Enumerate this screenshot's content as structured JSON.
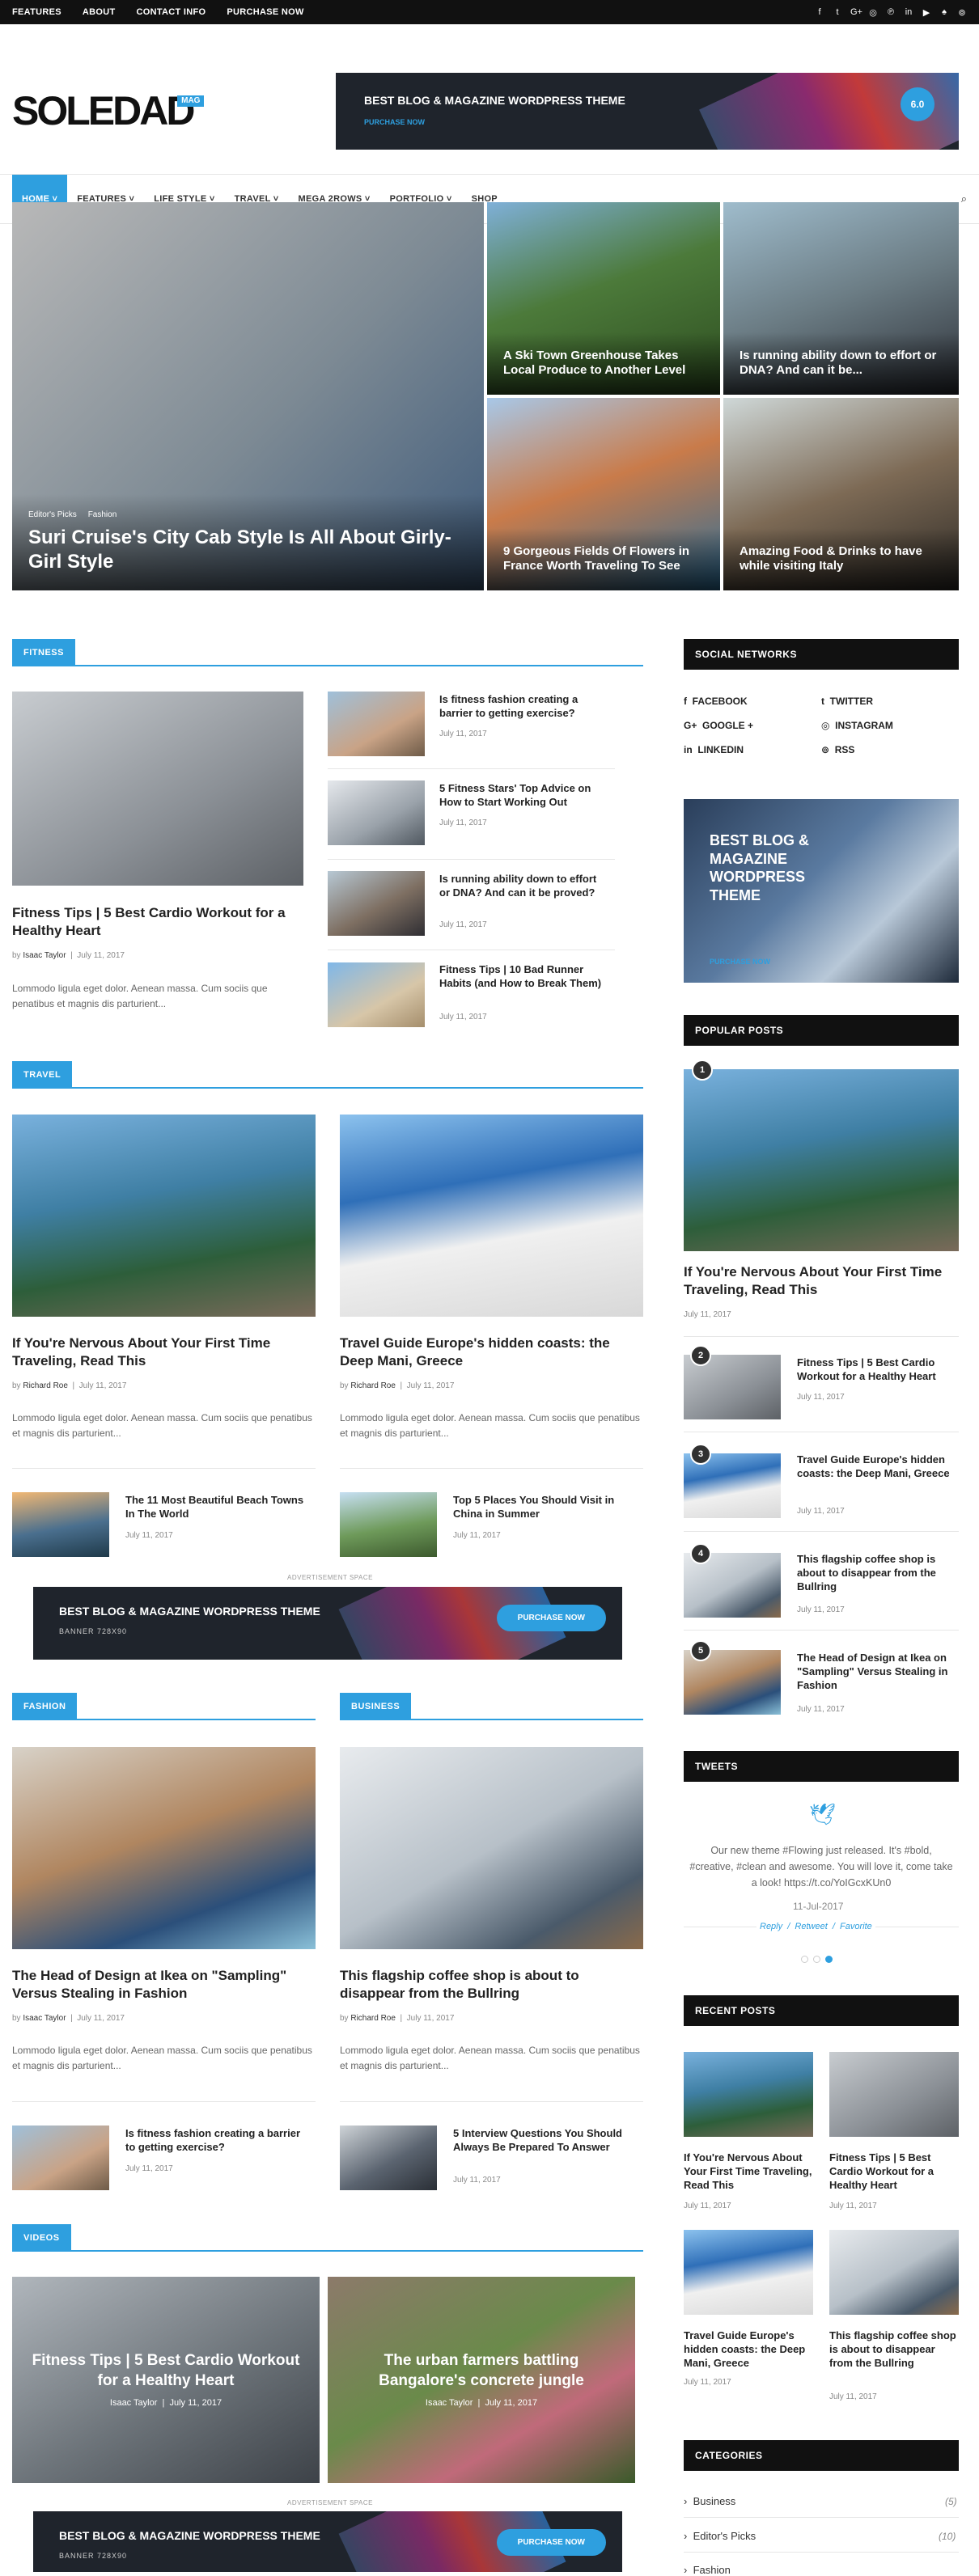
{
  "topbar": {
    "menu": [
      "FEATURES",
      "ABOUT",
      "CONTACT INFO",
      "PURCHASE NOW"
    ],
    "social_icons": [
      "facebook-icon",
      "twitter-icon",
      "google-plus-icon",
      "instagram-icon",
      "pinterest-icon",
      "linkedin-icon",
      "youtube-icon",
      "snapchat-icon",
      "rss-icon"
    ],
    "social_glyphs": [
      "f",
      "t",
      "G+",
      "◎",
      "℗",
      "in",
      "▶",
      "♠",
      "⊚"
    ]
  },
  "brand": {
    "logo": "SOLEDAD",
    "badge": "MAG"
  },
  "header_banner": {
    "title": "BEST BLOG & MAGAZINE WORDPRESS THEME",
    "cta": "PURCHASE NOW",
    "badge": "6.0"
  },
  "nav": {
    "items": [
      "HOME ˅",
      "FEATURES ˅",
      "LIFE STYLE ˅",
      "TRAVEL ˅",
      "MEGA 2ROWS ˅",
      "PORTFOLIO ˅",
      "SHOP"
    ],
    "search_glyph": "⌕"
  },
  "featured": {
    "main": {
      "tags": [
        "Editor's Picks",
        "Fashion"
      ],
      "title": "Suri Cruise's City Cab Style Is All About Girly-Girl Style"
    },
    "items": [
      "A Ski Town Greenhouse Takes Local Produce to Another Level",
      "Is running ability down to effort or DNA? And can it be...",
      "9 Gorgeous Fields Of Flowers in France Worth Traveling To See",
      "Amazing Food & Drinks to have while visiting Italy"
    ]
  },
  "fitness": {
    "heading": "FITNESS",
    "main": {
      "title": "Fitness Tips | 5 Best Cardio Workout for a Healthy Heart",
      "author": "Isaac Taylor",
      "date": "July 11, 2017",
      "excerpt": "Lommodo ligula eget dolor. Aenean massa. Cum sociis que penatibus et magnis dis parturient..."
    },
    "list": [
      {
        "title": "Is fitness fashion creating a barrier to getting exercise?",
        "date": "July 11, 2017"
      },
      {
        "title": "5 Fitness Stars' Top Advice on How to Start Working Out",
        "date": "July 11, 2017"
      },
      {
        "title": "Is running ability down to effort or DNA? And can it be proved?",
        "date": "July 11, 2017"
      },
      {
        "title": "Fitness Tips | 10 Bad Runner Habits (and How to Break Them)",
        "date": "July 11, 2017"
      }
    ]
  },
  "travel": {
    "heading": "TRAVEL",
    "posts": [
      {
        "title": "If You're Nervous About Your First Time Traveling, Read This",
        "author": "Richard Roe",
        "date": "July 11, 2017",
        "excerpt": "Lommodo ligula eget dolor. Aenean massa. Cum sociis que penatibus et magnis dis parturient..."
      },
      {
        "title": "Travel Guide Europe's hidden coasts: the Deep Mani, Greece",
        "author": "Richard Roe",
        "date": "July 11, 2017",
        "excerpt": "Lommodo ligula eget dolor. Aenean massa. Cum sociis que penatibus et magnis dis parturient..."
      }
    ],
    "small": [
      {
        "title": "The 11 Most Beautiful Beach Towns In The World",
        "date": "July 11, 2017"
      },
      {
        "title": "Top 5 Places You Should Visit in China in Summer",
        "date": "July 11, 2017"
      }
    ]
  },
  "ad": {
    "label": "ADVERTISEMENT SPACE",
    "title": "BEST BLOG & MAGAZINE WORDPRESS THEME",
    "sub": "BANNER 728X90",
    "cta": "PURCHASE NOW"
  },
  "fashion": {
    "heading": "FASHION",
    "post": {
      "title": "The Head of Design at Ikea on \"Sampling\" Versus Stealing in Fashion",
      "author": "Isaac Taylor",
      "date": "July 11, 2017",
      "excerpt": "Lommodo ligula eget dolor. Aenean massa. Cum sociis que penatibus et magnis dis parturient..."
    },
    "small": {
      "title": "Is fitness fashion creating a barrier to getting exercise?",
      "date": "July 11, 2017"
    }
  },
  "business": {
    "heading": "BUSINESS",
    "post": {
      "title": "This flagship coffee shop is about to disappear from the Bullring",
      "author": "Richard Roe",
      "date": "July 11, 2017",
      "excerpt": "Lommodo ligula eget dolor. Aenean massa. Cum sociis que penatibus et magnis dis parturient..."
    },
    "small": {
      "title": "5 Interview Questions You Should Always Be Prepared To Answer",
      "date": "July 11, 2017"
    }
  },
  "videos": {
    "heading": "VIDEOS",
    "items": [
      {
        "title": "Fitness Tips | 5 Best Cardio Workout for a Healthy Heart",
        "author": "Isaac Taylor",
        "date": "July 11, 2017"
      },
      {
        "title": "The urban farmers battling Bangalore's concrete jungle",
        "author": "Isaac Taylor",
        "date": "July 11, 2017"
      }
    ]
  },
  "sidebar": {
    "social_title": "SOCIAL NETWORKS",
    "social": [
      {
        "glyph": "f",
        "label": "FACEBOOK"
      },
      {
        "glyph": "t",
        "label": "TWITTER"
      },
      {
        "glyph": "G+",
        "label": "GOOGLE +"
      },
      {
        "glyph": "◎",
        "label": "INSTAGRAM"
      },
      {
        "glyph": "in",
        "label": "LINKEDIN"
      },
      {
        "glyph": "⊚",
        "label": "RSS"
      }
    ],
    "banner": {
      "title": "BEST BLOG & MAGAZINE WORDPRESS THEME",
      "cta": "PURCHASE NOW"
    },
    "popular_title": "POPULAR POSTS",
    "popular": [
      {
        "n": "1",
        "title": "If You're Nervous About Your First Time Traveling, Read This",
        "date": "July 11, 2017"
      },
      {
        "n": "2",
        "title": "Fitness Tips | 5 Best Cardio Workout for a Healthy Heart",
        "date": "July 11, 2017"
      },
      {
        "n": "3",
        "title": "Travel Guide Europe's hidden coasts: the Deep Mani, Greece",
        "date": "July 11, 2017"
      },
      {
        "n": "4",
        "title": "This flagship coffee shop is about to disappear from the Bullring",
        "date": "July 11, 2017"
      },
      {
        "n": "5",
        "title": "The Head of Design at Ikea on \"Sampling\" Versus Stealing in Fashion",
        "date": "July 11, 2017"
      }
    ],
    "tweets_title": "TWEETS",
    "tweet": {
      "text": "Our new theme #Flowing just released. It's #bold, #creative, #clean and awesome. You will love it, come take a look! https://t.co/YoIGcxKUn0",
      "date": "11-Jul-2017",
      "reply": "Reply",
      "retweet": "Retweet",
      "favorite": "Favorite"
    },
    "recent_title": "RECENT POSTS",
    "recent": [
      {
        "title": "If You're Nervous About Your First Time Traveling, Read This",
        "date": "July 11, 2017"
      },
      {
        "title": "Fitness Tips | 5 Best Cardio Workout for a Healthy Heart",
        "date": "July 11, 2017"
      },
      {
        "title": "Travel Guide Europe's hidden coasts: the Deep Mani, Greece",
        "date": "July 11, 2017"
      },
      {
        "title": "This flagship coffee shop is about to disappear from the Bullring",
        "date": "July 11, 2017"
      }
    ],
    "categories_title": "CATEGORIES",
    "categories": [
      {
        "name": "Business",
        "count": "(5)"
      },
      {
        "name": "Editor's Picks",
        "count": "(10)"
      },
      {
        "name": "Fashion",
        "count": ""
      }
    ]
  },
  "colors": {
    "accent": "#2e9fdf",
    "dark": "#111111"
  }
}
